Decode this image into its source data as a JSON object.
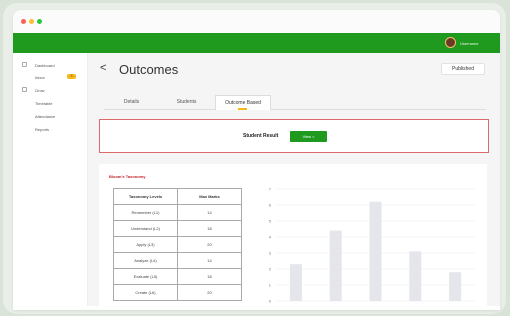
{
  "window": {
    "dots": [
      "#ff5f57",
      "#febc2e",
      "#28c840"
    ]
  },
  "topbar": {
    "user_name": "Username"
  },
  "sidebar": {
    "items": [
      {
        "label": "Dashboard"
      },
      {
        "label": "Inbox",
        "badge": "3"
      },
      {
        "label": "Grow"
      },
      {
        "label": "Timetable"
      },
      {
        "label": "Attendance"
      },
      {
        "label": "Reports"
      }
    ]
  },
  "page": {
    "back": "<",
    "title": "Outcomes",
    "status_button": "Published"
  },
  "tabs": [
    {
      "label": "Details"
    },
    {
      "label": "Students"
    },
    {
      "label": "Outcome Based",
      "active": true
    }
  ],
  "student_result": {
    "label": "Student Result",
    "button": "View  >"
  },
  "bloom": {
    "title": "Bloom's Taxonomy",
    "headers": [
      "Taxonomy Levels",
      "Max Marks"
    ],
    "rows": [
      [
        "Remember (L1)",
        "14"
      ],
      [
        "Understand (L2)",
        "18"
      ],
      [
        "Apply (L3)",
        "20"
      ],
      [
        "Analyze (L4)",
        "14"
      ],
      [
        "Evaluate (L5)",
        "18"
      ],
      [
        "Create (L6)",
        "20"
      ]
    ]
  },
  "chart_data": {
    "type": "bar",
    "y_ticks": [
      "0",
      "1",
      "2",
      "3",
      "4",
      "5",
      "6",
      "7"
    ],
    "ylim": [
      0,
      7
    ],
    "values": [
      2.3,
      4.4,
      6.2,
      3.1,
      1.8
    ],
    "bar_color": "#e4e6ec",
    "grid": true
  }
}
